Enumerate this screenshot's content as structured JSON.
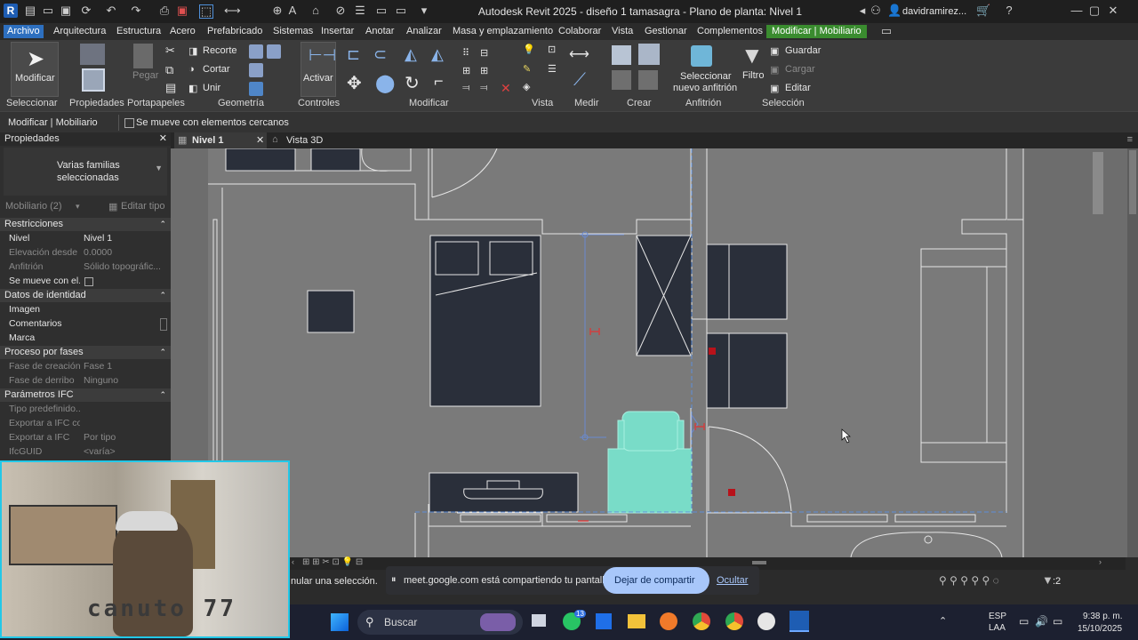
{
  "titlebar": {
    "title": "Autodesk Revit 2025 - diseño 1 tamasagra - Plano de planta: Nivel 1",
    "user": "davidramirez...",
    "app_icon": "R"
  },
  "menu": {
    "tabs": [
      "Archivo",
      "Arquitectura",
      "Estructura",
      "Acero",
      "Prefabricado",
      "Sistemas",
      "Insertar",
      "Anotar",
      "Analizar",
      "Masa y emplazamiento",
      "Colaborar",
      "Vista",
      "Gestionar",
      "Complementos",
      "Modificar | Mobiliario"
    ]
  },
  "ribbon": {
    "modificar": "Modificar",
    "pegar": "Pegar",
    "recorte": "Recorte",
    "cortar": "Cortar",
    "unir": "Unir",
    "activar": "Activar",
    "seleccionar_anfitrion": "Seleccionar",
    "nuevo_anfitrion": "nuevo anfitrión",
    "filtro": "Filtro",
    "guardar": "Guardar",
    "cargar": "Cargar",
    "editar": "Editar",
    "panels": [
      "Seleccionar",
      "Propiedades",
      "Portapapeles",
      "Geometría",
      "Controles",
      "Modificar",
      "Vista",
      "Medir",
      "Crear",
      "Anfitrión",
      "Selección"
    ]
  },
  "optionsbar": {
    "context": "Modificar | Mobiliario",
    "checkbox_label": "Se mueve con elementos cercanos"
  },
  "properties": {
    "title": "Propiedades",
    "type_line1": "Varias familias",
    "type_line2": "seleccionadas",
    "filter": "Mobiliario (2)",
    "edit_type": "Editar tipo",
    "sections": {
      "restricciones": "Restricciones",
      "identidad": "Datos de identidad",
      "fases": "Proceso por fases",
      "ifc": "Parámetros IFC"
    },
    "rows": {
      "nivel_k": "Nivel",
      "nivel_v": "Nivel 1",
      "elev_k": "Elevación desde ...",
      "elev_v": "0.0000",
      "anf_k": "Anfitrión",
      "anf_v": "Sólido topográfic...",
      "mueve_k": "Se mueve con el...",
      "imagen_k": "Imagen",
      "coment_k": "Comentarios",
      "marca_k": "Marca",
      "fcre_k": "Fase de creación",
      "fcre_v": "Fase 1",
      "fder_k": "Fase de derribo",
      "fder_v": "Ninguno",
      "tipo_k": "Tipo predefinido...",
      "expc_k": "Exportar a IFC co...",
      "exp_k": "Exportar a IFC",
      "exp_v": "Por tipo",
      "guid_k": "IfcGUID",
      "guid_v": "<varía>"
    }
  },
  "viewtabs": {
    "tab1": "Nivel 1",
    "tab2": "Vista 3D"
  },
  "status": {
    "left_text": "nular una selección.",
    "share_text": "meet.google.com está compartiendo tu pantalla.",
    "stop_share": "Dejar de compartir",
    "hide": "Ocultar",
    "filter_count": ":2"
  },
  "taskbar": {
    "search": "Buscar",
    "lang1": "ESP",
    "lang2": "LAA",
    "time": "9:38 p. m.",
    "date": "15/10/2025",
    "whatsapp_badge": "13"
  },
  "webcam": {
    "overlay_text": "canuto 77"
  },
  "colors": {
    "accent_blue": "#2d6fbf",
    "context_green": "#3a8c2f",
    "canvas": "#6d6d6d",
    "furniture": "#2a2f3a",
    "selected": "#79dcc8",
    "webcam_border": "#22c8e8"
  }
}
